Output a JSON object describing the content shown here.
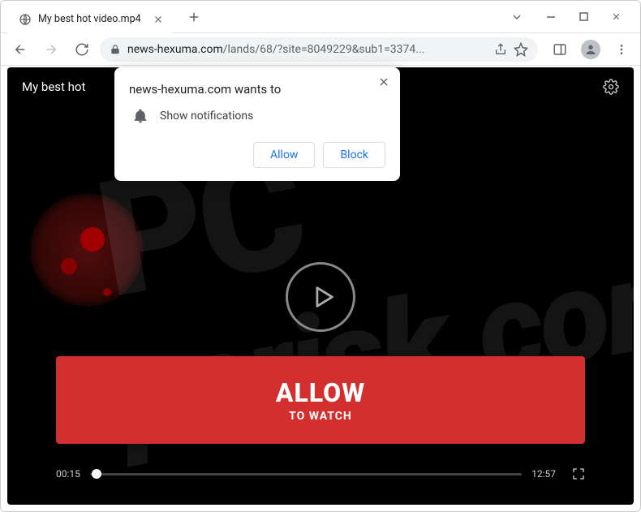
{
  "window": {
    "tab_title": "My best hot video.mp4",
    "url_host": "news-hexuma.com",
    "url_path": "/lands/68/?site=8049229&sub1=3374..."
  },
  "player": {
    "header_title": "My best hot",
    "time_current": "00:15",
    "time_total": "12:57"
  },
  "cta": {
    "main": "ALLOW",
    "sub": "TO WATCH"
  },
  "permission": {
    "site": "news-hexuma.com",
    "wants_to": " wants to",
    "line": "Show notifications",
    "allow": "Allow",
    "block": "Block"
  },
  "watermark": {
    "text": "pcrisk.com"
  }
}
